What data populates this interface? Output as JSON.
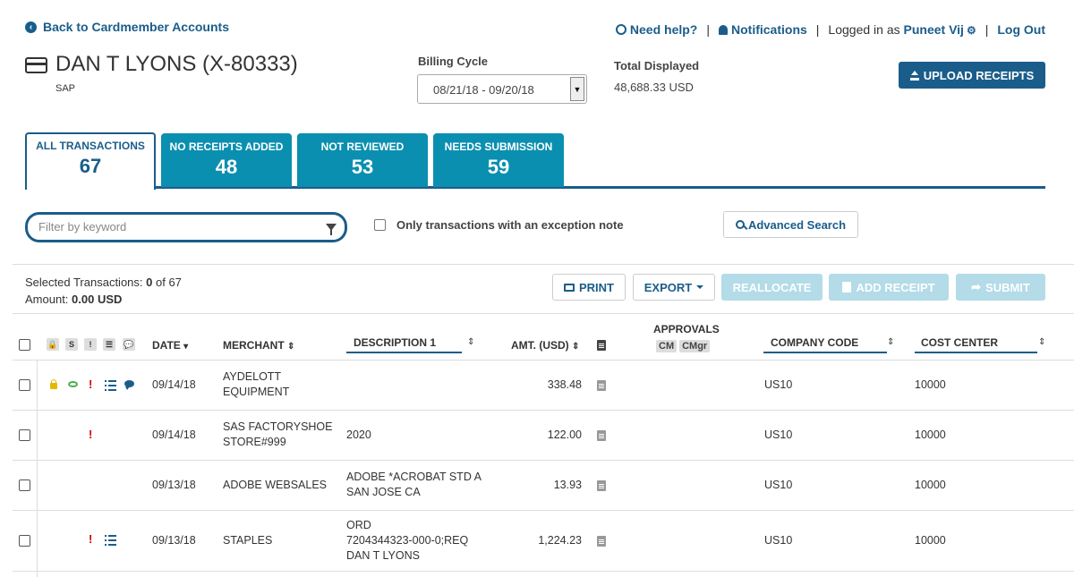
{
  "header": {
    "back_label": "Back to Cardmember Accounts",
    "help_label": "Need help?",
    "notifications_label": "Notifications",
    "sep": "|",
    "logged_in_label": "Logged in as",
    "user_name": "Puneet Vij",
    "logout_label": "Log Out"
  },
  "account": {
    "name": "DAN T LYONS (X-80333)",
    "sub": "SAP"
  },
  "billing": {
    "label": "Billing Cycle",
    "value": "08/21/18 - 09/20/18",
    "arrow": "▼"
  },
  "total": {
    "label": "Total Displayed",
    "value": "48,688.33 USD"
  },
  "upload_label": "UPLOAD RECEIPTS",
  "tabs": [
    {
      "label": "ALL TRANSACTIONS",
      "count": "67"
    },
    {
      "label": "NO RECEIPTS ADDED",
      "count": "48"
    },
    {
      "label": "NOT REVIEWED",
      "count": "53"
    },
    {
      "label": "NEEDS SUBMISSION",
      "count": "59"
    }
  ],
  "filter": {
    "placeholder": "Filter by keyword",
    "exception_label": "Only transactions with an exception note",
    "advanced_label": "Advanced Search"
  },
  "selection": {
    "count_prefix": "Selected Transactions: ",
    "count_selected": "0",
    "count_suffix": " of 67",
    "amount_prefix": "Amount: ",
    "amount_value": "0.00 USD"
  },
  "actions": {
    "print": "PRINT",
    "export": "EXPORT",
    "reallocate": "REALLOCATE",
    "add_receipt": "ADD RECEIPT",
    "submit": "SUBMIT"
  },
  "columns": {
    "icon_lock": "🔒",
    "icon_s": "S",
    "icon_excl": "!",
    "icon_list": "☰",
    "icon_comment": "💬",
    "date": "DATE",
    "merchant": "MERCHANT",
    "description": "DESCRIPTION 1",
    "amount": "AMT. (USD)",
    "approvals": "APPROVALS",
    "approval_cm": "CM",
    "approval_cmgr": "CMgr",
    "company_code": "COMPANY CODE",
    "cost_center": "COST CENTER",
    "sort_down": "▾",
    "sort_both": "⇕"
  },
  "rows": [
    {
      "date": "09/14/18",
      "merchant_1": "AYDELOTT",
      "merchant_2": "EQUIPMENT",
      "desc_1": "",
      "desc_2": "",
      "desc_3": "",
      "amount": "338.48",
      "company_code": "US10",
      "cost_center": "10000",
      "excl": "!"
    },
    {
      "date": "09/14/18",
      "merchant_1": "SAS FACTORYSHOE",
      "merchant_2": "STORE#999",
      "desc_1": "2020",
      "desc_2": "",
      "desc_3": "",
      "amount": "122.00",
      "company_code": "US10",
      "cost_center": "10000",
      "excl": "!"
    },
    {
      "date": "09/13/18",
      "merchant_1": "ADOBE WEBSALES",
      "merchant_2": "",
      "desc_1": "ADOBE *ACROBAT STD A",
      "desc_2": "SAN JOSE CA",
      "desc_3": "",
      "amount": "13.93",
      "company_code": "US10",
      "cost_center": "10000",
      "excl": ""
    },
    {
      "date": "09/13/18",
      "merchant_1": "STAPLES",
      "merchant_2": "",
      "desc_1": "ORD",
      "desc_2": "7204344323-000-0;REQ",
      "desc_3": "DAN T LYONS",
      "amount": "1,224.23",
      "company_code": "US10",
      "cost_center": "10000",
      "excl": "!"
    }
  ],
  "colors": {
    "brand": "#1a5d8a",
    "tab": "#0b8fb0",
    "disabled": "#b3dbe8",
    "alert": "#d40000"
  }
}
